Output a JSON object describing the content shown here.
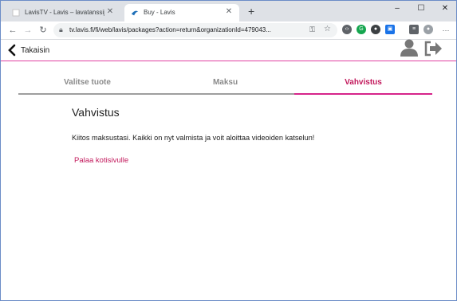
{
  "browser": {
    "tabs": [
      {
        "title": "LavisTV - Lavis – lavatanssijumpp",
        "close": "✕"
      },
      {
        "title": "Buy - Lavis",
        "close": "✕"
      }
    ],
    "new_tab": "+",
    "window_controls": {
      "minimize": "–",
      "maximize": "☐",
      "close": "✕"
    },
    "url": "tv.lavis.fi/fi/web/lavis/packages?action=return&organizationId=479043..."
  },
  "app": {
    "back_label": "Takaisin",
    "accent_color": "#d6248a",
    "steps": [
      "Valitse tuote",
      "Maksu",
      "Vahvistus"
    ],
    "active_step": "Vahvistus",
    "heading": "Vahvistus",
    "message": "Kiitos maksustasi. Kaikki on nyt valmista ja voit aloittaa videoiden katselun!",
    "home_link": "Palaa kotisivulle"
  }
}
